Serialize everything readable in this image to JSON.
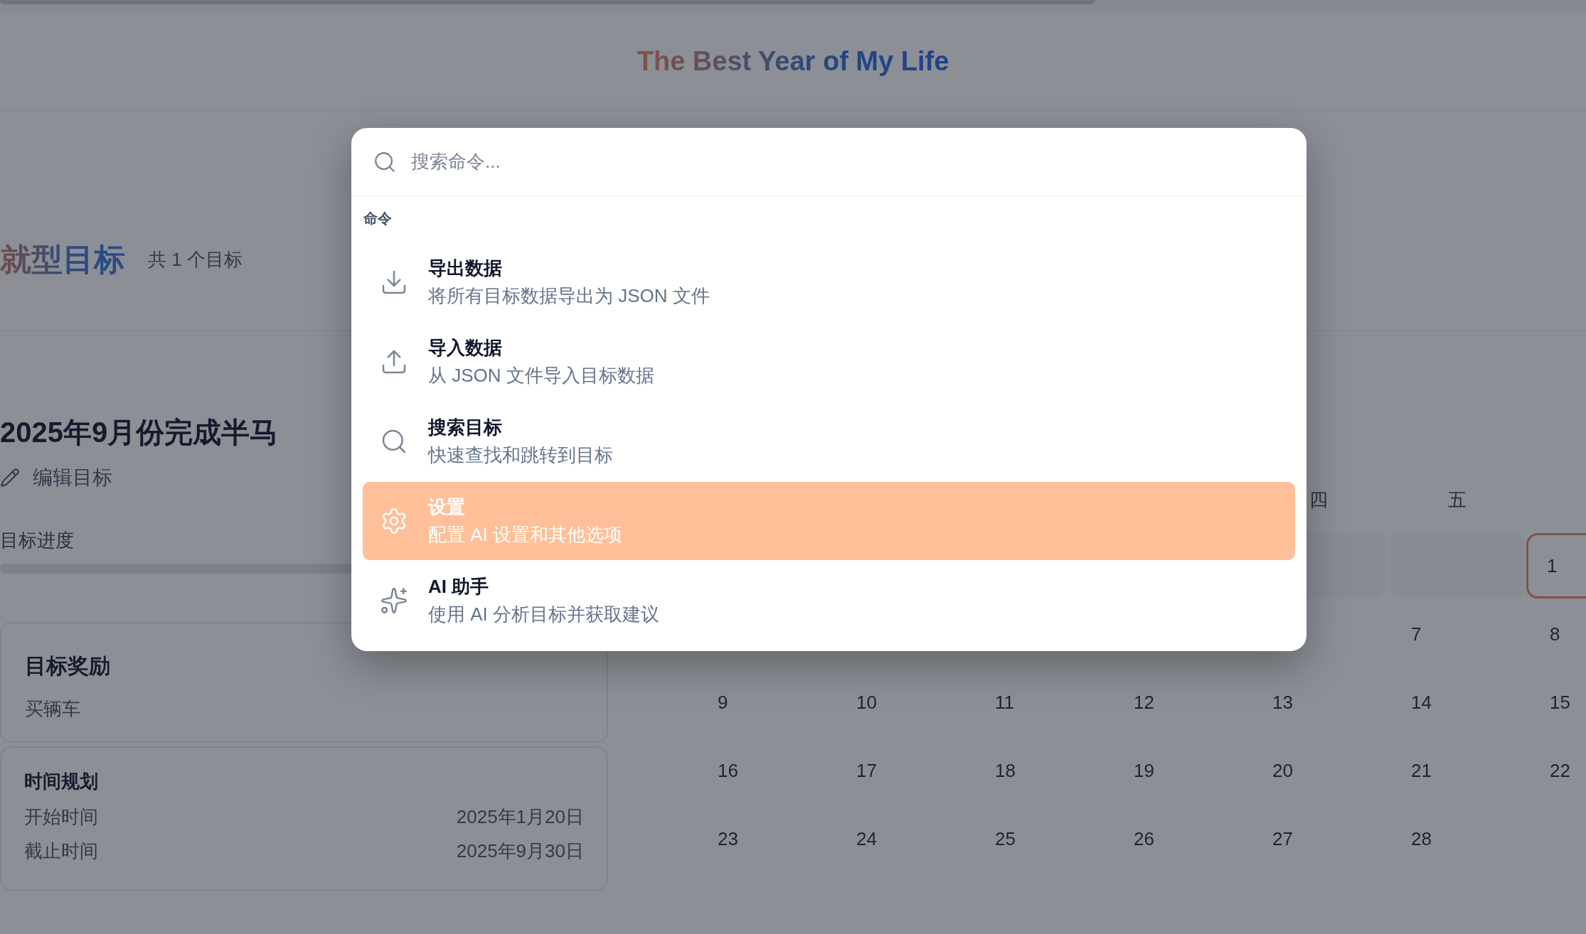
{
  "header": {
    "title": "The Best Year of My Life"
  },
  "section": {
    "title": "就型目标",
    "count": "共 1 个目标"
  },
  "goal": {
    "title": "2025年9月份完成半马",
    "edit_label": "编辑目标",
    "progress_label": "目标进度",
    "progress": {
      "level": 0
    },
    "reward": {
      "title": "目标奖励",
      "text": "买辆车"
    },
    "schedule": {
      "title": "时间规划",
      "rows": [
        {
          "label": "开始时间",
          "value": "2025年1月20日"
        },
        {
          "label": "截止时间",
          "value": "2025年9月30日"
        }
      ]
    }
  },
  "calendar": {
    "weekdays": [
      {
        "kind": "covered"
      },
      {
        "kind": "covered"
      },
      {
        "kind": "covered"
      },
      {
        "kind": "covered"
      },
      {
        "kind": "label",
        "label": "四"
      },
      {
        "kind": "label",
        "label": "五"
      },
      {
        "kind": "covered"
      }
    ],
    "weeks": [
      {
        "days": [
          {
            "kind": "covered"
          },
          {
            "kind": "covered"
          },
          {
            "kind": "covered"
          },
          {
            "kind": "covered"
          },
          {
            "kind": "blank"
          },
          {
            "kind": "blank"
          },
          {
            "kind": "day",
            "label": "1",
            "today": true
          }
        ]
      },
      {
        "days": [
          {
            "kind": "covered"
          },
          {
            "kind": "covered"
          },
          {
            "kind": "covered"
          },
          {
            "kind": "covered"
          },
          {
            "kind": "covered"
          },
          {
            "kind": "day",
            "label": "7",
            "today": false
          },
          {
            "kind": "day",
            "label": "8",
            "today": false
          }
        ]
      },
      {
        "days": [
          {
            "kind": "day",
            "label": "9",
            "today": false
          },
          {
            "kind": "day",
            "label": "10",
            "today": false
          },
          {
            "kind": "day",
            "label": "11",
            "today": false
          },
          {
            "kind": "day",
            "label": "12",
            "today": false
          },
          {
            "kind": "day",
            "label": "13",
            "today": false
          },
          {
            "kind": "day",
            "label": "14",
            "today": false
          },
          {
            "kind": "day",
            "label": "15",
            "today": false
          }
        ]
      },
      {
        "days": [
          {
            "kind": "day",
            "label": "16",
            "today": false
          },
          {
            "kind": "day",
            "label": "17",
            "today": false
          },
          {
            "kind": "day",
            "label": "18",
            "today": false
          },
          {
            "kind": "day",
            "label": "19",
            "today": false
          },
          {
            "kind": "day",
            "label": "20",
            "today": false
          },
          {
            "kind": "day",
            "label": "21",
            "today": false
          },
          {
            "kind": "day",
            "label": "22",
            "today": false
          }
        ]
      },
      {
        "days": [
          {
            "kind": "day",
            "label": "23",
            "today": false
          },
          {
            "kind": "day",
            "label": "24",
            "today": false
          },
          {
            "kind": "day",
            "label": "25",
            "today": false
          },
          {
            "kind": "day",
            "label": "26",
            "today": false
          },
          {
            "kind": "day",
            "label": "27",
            "today": false
          },
          {
            "kind": "day",
            "label": "28",
            "today": false
          }
        ]
      }
    ]
  },
  "command_palette": {
    "search": {
      "placeholder": "搜索命令..."
    },
    "group_label": "命令",
    "commands": [
      {
        "kind": "download",
        "title": "导出数据",
        "description": "将所有目标数据导出为 JSON 文件",
        "selected": false
      },
      {
        "kind": "upload",
        "title": "导入数据",
        "description": "从 JSON 文件导入目标数据",
        "selected": false
      },
      {
        "kind": "search",
        "title": "搜索目标",
        "description": "快速查找和跳转到目标",
        "selected": false
      },
      {
        "kind": "settings",
        "title": "设置",
        "description": "配置 AI 设置和其他选项",
        "selected": true
      },
      {
        "kind": "sparkles",
        "title": "AI 助手",
        "description": "使用 AI 分析目标并获取建议",
        "selected": false
      }
    ]
  }
}
